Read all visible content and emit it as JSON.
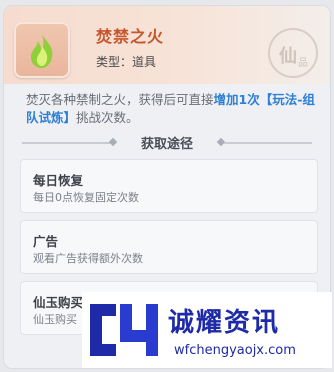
{
  "item": {
    "title": "焚禁之火",
    "type_label": "类型：道具",
    "seal_text": "仙",
    "seal_sub": "品",
    "description_prefix": "焚灭各种禁制之火，获得后可直接",
    "description_highlight": "增加1次【玩法-组队试炼】",
    "description_suffix": "挑战次数。"
  },
  "section": {
    "title": "获取途径"
  },
  "routes": [
    {
      "title": "每日恢复",
      "desc": "每日0点恢复固定次数"
    },
    {
      "title": "广告",
      "desc": "观看广告获得额外次数"
    },
    {
      "title": "仙玉购买",
      "desc": "仙玉购买"
    }
  ],
  "watermark": {
    "name": "诚耀资讯",
    "url": "wfchengyaojx.com"
  },
  "colors": {
    "title": "#c5562e",
    "highlight": "#2f7fd3",
    "logo": "#1e2aa8"
  }
}
